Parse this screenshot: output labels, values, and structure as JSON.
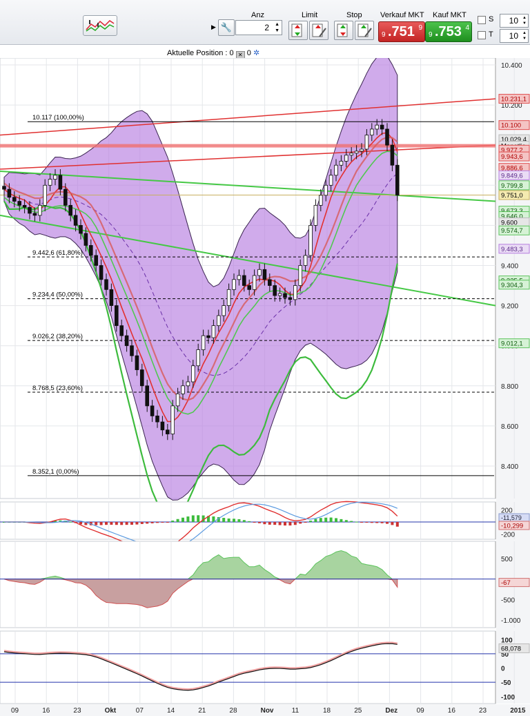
{
  "toolbar": {
    "anz_label": "Anz",
    "limit_label": "Limit",
    "stop_label": "Stop",
    "sell_label": "Verkauf MKT",
    "buy_label": "Kauf MKT",
    "qty_value": "2",
    "sell_price": {
      "prefix": "9",
      "main": ".751",
      "sup": "9"
    },
    "buy_price": {
      "prefix": "9",
      "main": ".753",
      "sup": "4"
    },
    "s_label": "S",
    "t_label": "T",
    "s_value": "10",
    "t_value": "10"
  },
  "position": {
    "label": "Aktuelle Position : 0",
    "value2": "0"
  },
  "colors": {
    "sell": "#c32424",
    "buy": "#1e8f1e",
    "band": "#b77ee0",
    "red": "#e23030",
    "green": "#3dbb3d"
  },
  "icons": [
    "chart-icon",
    "wrench-icon",
    "spin-arrows-icon",
    "order-icon",
    "close-icon",
    "settings-icon"
  ],
  "chart_data": {
    "type": "candlestick",
    "ylim": [
      8300,
      10500
    ],
    "yticks": [
      "10.400",
      "10.200",
      "10.000",
      "9.800",
      "9.600",
      "9.400",
      "9.200",
      "9.000",
      "8.800",
      "8.600",
      "8.400"
    ],
    "xticks": [
      "09",
      "16",
      "23",
      "Okt",
      "07",
      "14",
      "21",
      "28",
      "Nov",
      "11",
      "18",
      "25",
      "Dez",
      "09",
      "16",
      "23",
      "2015"
    ],
    "fib_levels": [
      {
        "label": "10.117 (100,00%)",
        "value": 10117
      },
      {
        "label": "9.442,6 (61,80%)",
        "value": 9442.6
      },
      {
        "label": "9.234,4 (50,00%)",
        "value": 9234.4
      },
      {
        "label": "9.026,2 (38,20%)",
        "value": 9026.2
      },
      {
        "label": "8.768,5 (23,60%)",
        "value": 8768.5
      },
      {
        "label": "8.352,1 (0,00%)",
        "value": 8352.1
      }
    ],
    "price_tags": [
      {
        "text": "10.231,1",
        "value": 10231.1,
        "style": "red"
      },
      {
        "text": "10.100",
        "value": 10100,
        "style": "red"
      },
      {
        "text": "10.029,4",
        "value": 10029.4,
        "style": "gray"
      },
      {
        "text": "Monatlic",
        "value": 9997,
        "style": "gray"
      },
      {
        "text": "9.977,2",
        "value": 9977.2,
        "style": "red"
      },
      {
        "text": "9.943,6",
        "value": 9943.6,
        "style": "red"
      },
      {
        "text": "9.886,6",
        "value": 9886.6,
        "style": "red"
      },
      {
        "text": "9.849,6",
        "value": 9849.6,
        "style": "purple"
      },
      {
        "text": "9.799,8",
        "value": 9799.8,
        "style": "green"
      },
      {
        "text": "9.751,0",
        "value": 9751.0,
        "style": "yellow"
      },
      {
        "text": "9.673,3",
        "value": 9673.3,
        "style": "green"
      },
      {
        "text": "9.646,0",
        "value": 9646.0,
        "style": "green"
      },
      {
        "text": "9.600",
        "value": 9615,
        "style": "gray"
      },
      {
        "text": "9.574,7",
        "value": 9574.7,
        "style": "green"
      },
      {
        "text": "9.483,3",
        "value": 9483.3,
        "style": "purple"
      },
      {
        "text": "9.325,5",
        "value": 9325.5,
        "style": "green"
      },
      {
        "text": "9.304,3",
        "value": 9304.3,
        "style": "green"
      },
      {
        "text": "9.012,1",
        "value": 9012.1,
        "style": "green"
      }
    ],
    "close": [
      9780,
      9740,
      9720,
      9700,
      9690,
      9660,
      9650,
      9700,
      9800,
      9830,
      9850,
      9780,
      9700,
      9650,
      9600,
      9560,
      9500,
      9450,
      9400,
      9330,
      9280,
      9200,
      9100,
      9050,
      9000,
      8950,
      8880,
      8800,
      8700,
      8650,
      8620,
      8580,
      8560,
      8700,
      8760,
      8800,
      8820,
      8900,
      8980,
      9050,
      9040,
      9100,
      9150,
      9200,
      9280,
      9330,
      9350,
      9300,
      9280,
      9350,
      9380,
      9330,
      9300,
      9250,
      9260,
      9240,
      9230,
      9300,
      9400,
      9450,
      9600,
      9700,
      9750,
      9800,
      9850,
      9900,
      9920,
      9950,
      9960,
      9970,
      9980,
      10050,
      10080,
      10100,
      10080,
      10000,
      9900,
      9751
    ],
    "macd": {
      "ylim": [
        -260,
        260
      ],
      "yticks": [
        "200",
        "-200"
      ],
      "tags": [
        "-11,579",
        "-10,299"
      ]
    },
    "momentum": {
      "ylim": [
        -1150,
        750
      ],
      "yticks": [
        "500",
        "-500",
        "-1.000"
      ],
      "tag": "-67"
    },
    "stoch": {
      "ylim": [
        -120,
        120
      ],
      "yticks": [
        "100",
        "50",
        "0",
        "-50",
        "-100"
      ],
      "tag": "68,078"
    }
  }
}
